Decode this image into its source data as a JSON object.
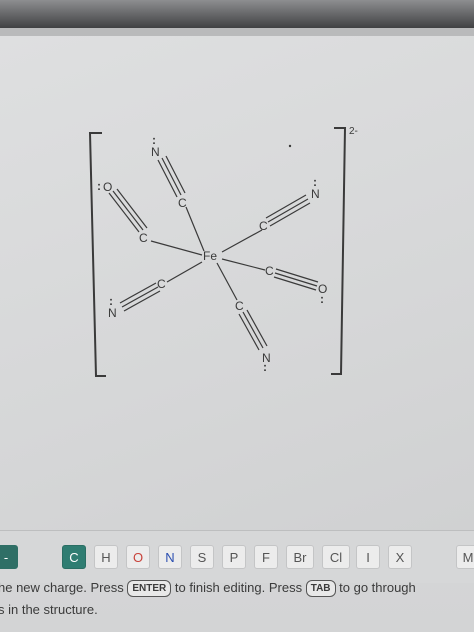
{
  "structure": {
    "charge": "2-",
    "center_atom": "Fe",
    "ligand_c_labels": [
      "C",
      "C",
      "C",
      "C",
      "C",
      "C"
    ],
    "n_labels": [
      "N",
      "N",
      "N",
      "N"
    ],
    "o_labels": [
      "O",
      "O"
    ],
    "lone_pair": ":"
  },
  "toolbar": {
    "left_button": "-",
    "elements": [
      "C",
      "H",
      "O",
      "N",
      "S",
      "P",
      "F",
      "Br",
      "Cl",
      "I"
    ],
    "close_label": "X",
    "more_label": "M"
  },
  "help": {
    "line1_a": "he new charge. Press",
    "enter_key": "ENTER",
    "line1_b": "to finish editing. Press",
    "tab_key": "TAB",
    "line1_c": "to go through",
    "line2": "s in the structure."
  }
}
